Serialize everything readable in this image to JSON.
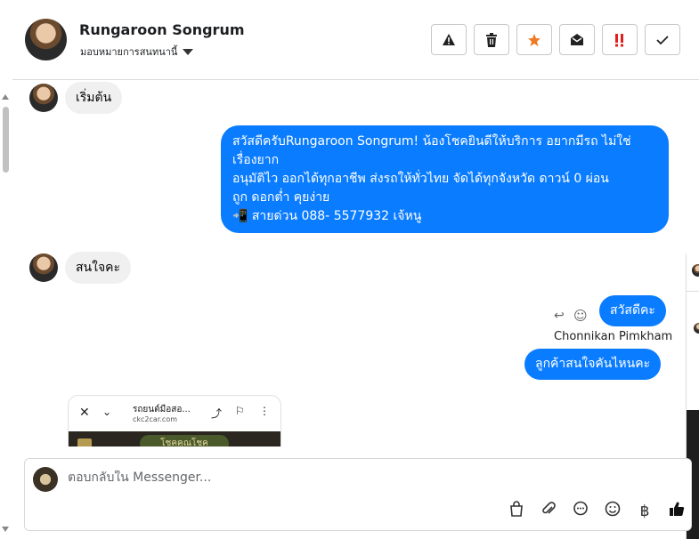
{
  "header": {
    "contact_name": "Rungaroon Songrum",
    "contact_sub": "มอบหมายการสนทนานี้",
    "actions": [
      {
        "name": "report-spam-button",
        "glyph": "⚠"
      },
      {
        "name": "delete-button",
        "glyph": "🗑"
      },
      {
        "name": "star-button",
        "glyph": "★",
        "color": "#f07a22"
      },
      {
        "name": "mark-unread-button",
        "glyph": "✉"
      },
      {
        "name": "important-button",
        "glyph": "!!",
        "color": "#e02020"
      },
      {
        "name": "mark-done-button",
        "glyph": "✓"
      }
    ]
  },
  "messages": {
    "in1": "เริ่มต้น",
    "out1_lines": [
      "สวัสดีครับRungaroon Songrum! น้องโชคยินดีให้บริการ อยากมีรถ ไม่ใช่",
      "เรื่องยาก",
      "อนุมัติไว ออกได้ทุกอาชีพ ส่งรถให้ทั่วไทย จัดได้ทุกจังหวัด ดาวน์ 0  ผ่อน",
      "ถูก ดอกต่ำ คุยง่าย",
      "📲 สายด่วน 088- 5577932 เจ้หนู"
    ],
    "in2": "สนใจคะ",
    "out2": "สวัสดีคะ",
    "sender": "Chonnikan Pimkham",
    "out3": "ลูกค้าสนใจคันไหนคะ"
  },
  "preview": {
    "title": "รถยนต์มือสอ...",
    "url": "ckc2car.com",
    "logo_text": "โชคคูณโชค"
  },
  "composer": {
    "placeholder": "ตอบกลับใน Messenger..."
  },
  "colors": {
    "accent": "#0a7cff",
    "incoming_bubble": "#f0f0f0"
  }
}
